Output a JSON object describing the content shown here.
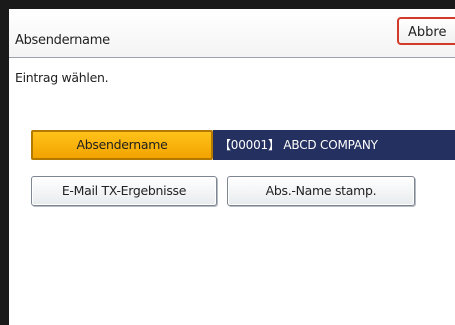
{
  "header": {
    "title": "Absendername",
    "cancel_label": "Abbre"
  },
  "instruction": "Eintrag wählen.",
  "selection": {
    "label": "Absendername",
    "value": "【00001】 ABCD COMPANY"
  },
  "buttons": {
    "email_tx_results": "E-Mail TX-Ergebnisse",
    "sender_name_stamp": "Abs.-Name stamp."
  },
  "colors": {
    "selected_button": "#f5a800",
    "value_bar": "#24305f",
    "cancel_border": "#d23b2a"
  }
}
